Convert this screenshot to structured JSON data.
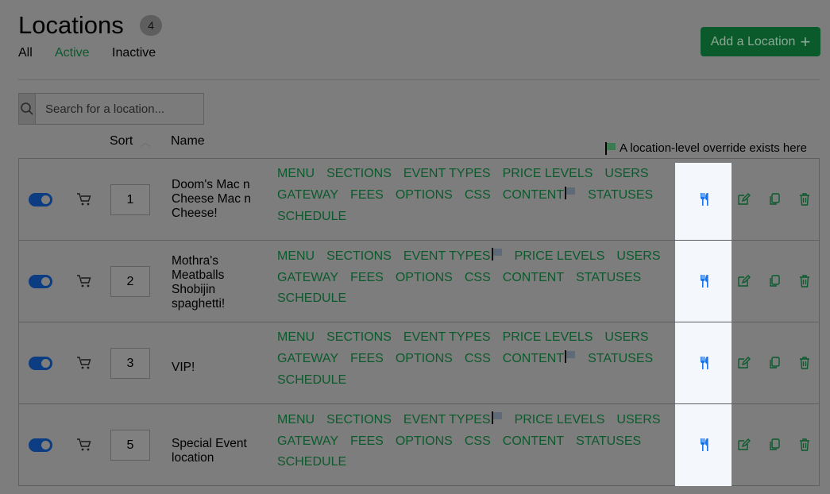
{
  "header": {
    "title": "Locations",
    "count": "4",
    "tabs": {
      "all": "All",
      "active": "Active",
      "inactive": "Inactive"
    },
    "add_button": "Add a Location",
    "add_button_icon": "plus-icon"
  },
  "search": {
    "placeholder": "Search for a location...",
    "value": ""
  },
  "table": {
    "col_sort": "Sort",
    "col_name": "Name",
    "override_note": "A location-level override exists here"
  },
  "colors": {
    "accent_green": "#0b5a2c",
    "toggle_blue": "#0c3c82",
    "menu_icon_blue": "#1a73e8",
    "highlight": "#f4f8fc",
    "overlay_gray": "#7d7d7d"
  },
  "rows": [
    {
      "sort": "1",
      "name": "Doom's Mac n Cheese Mac n Cheese!",
      "links": [
        {
          "label": "MENU",
          "flag": false
        },
        {
          "label": "SECTIONS",
          "flag": false
        },
        {
          "label": "EVENT TYPES",
          "flag": false
        },
        {
          "label": "PRICE LEVELS",
          "flag": false
        },
        {
          "label": "USERS",
          "flag": false
        },
        {
          "label": "GATEWAY",
          "flag": false
        },
        {
          "label": "FEES",
          "flag": false
        },
        {
          "label": "OPTIONS",
          "flag": false
        },
        {
          "label": "CSS",
          "flag": false
        },
        {
          "label": "CONTENT",
          "flag": true
        },
        {
          "label": "STATUSES",
          "flag": false
        },
        {
          "label": "SCHEDULE",
          "flag": false
        }
      ]
    },
    {
      "sort": "2",
      "name": "Mothra's Meatballs Shobijin spaghetti!",
      "links": [
        {
          "label": "MENU",
          "flag": false
        },
        {
          "label": "SECTIONS",
          "flag": false
        },
        {
          "label": "EVENT TYPES",
          "flag": true
        },
        {
          "label": "PRICE LEVELS",
          "flag": false
        },
        {
          "label": "USERS",
          "flag": false
        },
        {
          "label": "GATEWAY",
          "flag": false
        },
        {
          "label": "FEES",
          "flag": false
        },
        {
          "label": "OPTIONS",
          "flag": false
        },
        {
          "label": "CSS",
          "flag": false
        },
        {
          "label": "CONTENT",
          "flag": false
        },
        {
          "label": "STATUSES",
          "flag": false
        },
        {
          "label": "SCHEDULE",
          "flag": false
        }
      ]
    },
    {
      "sort": "3",
      "name": "VIP!",
      "links": [
        {
          "label": "MENU",
          "flag": false
        },
        {
          "label": "SECTIONS",
          "flag": false
        },
        {
          "label": "EVENT TYPES",
          "flag": false
        },
        {
          "label": "PRICE LEVELS",
          "flag": false
        },
        {
          "label": "USERS",
          "flag": false
        },
        {
          "label": "GATEWAY",
          "flag": false
        },
        {
          "label": "FEES",
          "flag": false
        },
        {
          "label": "OPTIONS",
          "flag": false
        },
        {
          "label": "CSS",
          "flag": false
        },
        {
          "label": "CONTENT",
          "flag": true
        },
        {
          "label": "STATUSES",
          "flag": false
        },
        {
          "label": "SCHEDULE",
          "flag": false
        }
      ]
    },
    {
      "sort": "5",
      "name": "Special Event location",
      "links": [
        {
          "label": "MENU",
          "flag": false
        },
        {
          "label": "SECTIONS",
          "flag": false
        },
        {
          "label": "EVENT TYPES",
          "flag": true
        },
        {
          "label": "PRICE LEVELS",
          "flag": false
        },
        {
          "label": "USERS",
          "flag": false
        },
        {
          "label": "GATEWAY",
          "flag": false
        },
        {
          "label": "FEES",
          "flag": false
        },
        {
          "label": "OPTIONS",
          "flag": false
        },
        {
          "label": "CSS",
          "flag": false
        },
        {
          "label": "CONTENT",
          "flag": false
        },
        {
          "label": "STATUSES",
          "flag": false
        },
        {
          "label": "SCHEDULE",
          "flag": false
        }
      ]
    }
  ],
  "row_icons": [
    "toggle-switch",
    "cart-icon",
    "menu-icon",
    "edit-icon",
    "copy-icon",
    "delete-icon"
  ]
}
